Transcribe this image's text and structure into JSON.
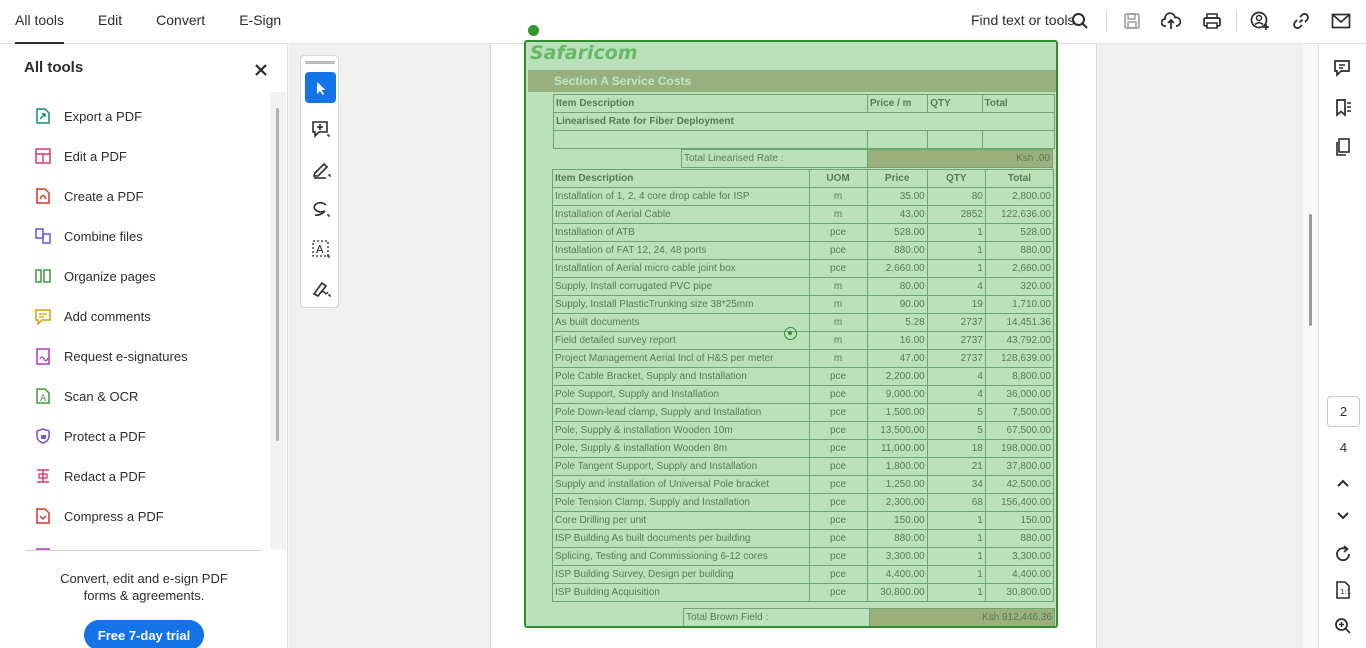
{
  "topnav": {
    "tabs": [
      "All tools",
      "Edit",
      "Convert",
      "E-Sign"
    ]
  },
  "topbar": {
    "find_label": "Find text or tools"
  },
  "leftpanel": {
    "title": "All tools",
    "tools": [
      {
        "label": "Export a PDF",
        "icon": "export-pdf-icon",
        "color": "#0f8c7e"
      },
      {
        "label": "Edit a PDF",
        "icon": "edit-pdf-icon",
        "color": "#d93a6a"
      },
      {
        "label": "Create a PDF",
        "icon": "create-pdf-icon",
        "color": "#d9302b"
      },
      {
        "label": "Combine files",
        "icon": "combine-files-icon",
        "color": "#5b5bd6"
      },
      {
        "label": "Organize pages",
        "icon": "organize-pages-icon",
        "color": "#3d9a3d"
      },
      {
        "label": "Add comments",
        "icon": "add-comments-icon",
        "color": "#d8a200"
      },
      {
        "label": "Request e-signatures",
        "icon": "request-esignatures-icon",
        "color": "#b13ab7"
      },
      {
        "label": "Scan & OCR",
        "icon": "scan-ocr-icon",
        "color": "#3d9a3d"
      },
      {
        "label": "Protect a PDF",
        "icon": "protect-pdf-icon",
        "color": "#7b53d6"
      },
      {
        "label": "Redact a PDF",
        "icon": "redact-pdf-icon",
        "color": "#d93a6a"
      },
      {
        "label": "Compress a PDF",
        "icon": "compress-pdf-icon",
        "color": "#d9302b"
      }
    ],
    "promo_line1": "Convert, edit and e-sign PDF",
    "promo_line2": "forms & agreements.",
    "trial_button": "Free 7-day trial"
  },
  "document": {
    "logo": "Safaricom",
    "section_title": "Section A Service Costs",
    "top_header": [
      "Item Description",
      "Price / m",
      "QTY",
      "Total"
    ],
    "top_row": "Linearised Rate for Fiber Deployment",
    "total_linearised_label": "Total Linearised Rate :",
    "total_linearised_value": "Ksh .00",
    "header": [
      "Item Description",
      "UOM",
      "Price",
      "QTY",
      "Total"
    ],
    "rows": [
      [
        "Installation of 1, 2, 4 core drop cable for ISP",
        "m",
        "35.00",
        "80",
        "2,800.00"
      ],
      [
        "Installation of Aerial Cable",
        "m",
        "43.00",
        "2852",
        "122,636.00"
      ],
      [
        "Installation of ATB",
        "pce",
        "528.00",
        "1",
        "528.00"
      ],
      [
        "Installation of FAT 12, 24, 48 ports",
        "pce",
        "880.00",
        "1",
        "880.00"
      ],
      [
        "Installation of Aerial micro cable joint box",
        "pce",
        "2,660.00",
        "1",
        "2,660.00"
      ],
      [
        "Supply, Install corrugated PVC pipe",
        "m",
        "80.00",
        "4",
        "320.00"
      ],
      [
        "Supply, Install PlasticTrunking size 38*25mm",
        "m",
        "90.00",
        "19",
        "1,710.00"
      ],
      [
        " As built documents",
        "m",
        "5.28",
        "2737",
        "14,451.36"
      ],
      [
        " Field detailed survey report",
        "m",
        "16.00",
        "2737",
        "43,792.00"
      ],
      [
        "Project Management Aerial Incl of H&S per meter",
        "m",
        "47.00",
        "2737",
        "128,639.00"
      ],
      [
        "Pole Cable Bracket, Supply and Installation",
        "pce",
        "2,200.00",
        "4",
        "8,800.00"
      ],
      [
        "Pole Support, Supply and Installation",
        "pce",
        "9,000.00",
        "4",
        "36,000.00"
      ],
      [
        "Pole Down-lead clamp, Supply and Installation",
        "pce",
        "1,500.00",
        "5",
        "7,500.00"
      ],
      [
        "Pole, Supply & installation Wooden 10m",
        "pce",
        "13,500.00",
        "5",
        "67,500.00"
      ],
      [
        "Pole, Supply & installation Wooden 8m",
        "pce",
        "11,000.00",
        "18",
        "198,000.00"
      ],
      [
        "Pole Tangent Support, Supply and Installation",
        "pce",
        "1,800.00",
        "21",
        "37,800.00"
      ],
      [
        "Supply and installation of Universal Pole bracket",
        "pce",
        "1,250.00",
        "34",
        "42,500.00"
      ],
      [
        "Pole Tension Clamp, Supply and Installation",
        "pce",
        "2,300.00",
        "68",
        "156,400.00"
      ],
      [
        "Core Drilling per unit",
        "pce",
        "150.00",
        "1",
        "150.00"
      ],
      [
        "ISP Building As built documents per building",
        "pce",
        "880.00",
        "1",
        "880.00"
      ],
      [
        "Splicing, Testing and Commissioning 6-12 cores",
        "pce",
        "3,300.00",
        "1",
        "3,300.00"
      ],
      [
        "ISP Building Survey, Design per building",
        "pce",
        "4,400.00",
        "1",
        "4,400.00"
      ],
      [
        "ISP Building Acquisition",
        "pce",
        "30,800.00",
        "1",
        "30,800.00"
      ]
    ],
    "total_brown_label": "Total Brown Field :",
    "total_brown_value": "Ksh 912,446.36"
  },
  "pager": {
    "current": "2",
    "total": "4"
  }
}
